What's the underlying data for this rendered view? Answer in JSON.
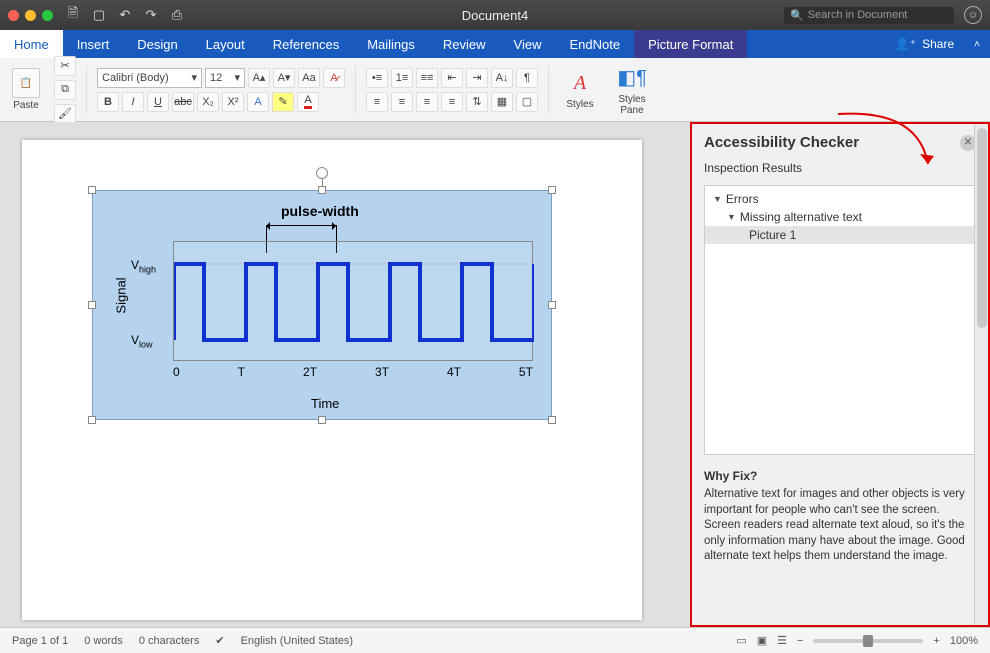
{
  "window": {
    "title": "Document4",
    "search_placeholder": "Search in Document"
  },
  "tabs": {
    "home": "Home",
    "insert": "Insert",
    "design": "Design",
    "layout": "Layout",
    "references": "References",
    "mailings": "Mailings",
    "review": "Review",
    "view": "View",
    "endnote": "EndNote",
    "picture_format": "Picture Format",
    "share": "Share"
  },
  "ribbon": {
    "paste": "Paste",
    "font_name": "Calibri (Body)",
    "font_size": "12",
    "styles": "Styles",
    "styles_pane": "Styles\nPane"
  },
  "picture": {
    "title": "pulse-width",
    "y_label": "Signal",
    "x_label": "Time",
    "v_high": "V",
    "v_high_sub": "high",
    "v_low": "V",
    "v_low_sub": "low",
    "x_ticks": [
      "0",
      "T",
      "2T",
      "3T",
      "4T",
      "5T"
    ]
  },
  "pane": {
    "title": "Accessibility Checker",
    "subtitle": "Inspection Results",
    "errors_label": "Errors",
    "err1": "Missing alternative text",
    "err1_item": "Picture 1",
    "why_title": "Why Fix?",
    "why_body": "Alternative text for images and other objects is very important for people who can't see the screen. Screen readers read alternate text aloud, so it's the only information many have about the image. Good alternate text helps them understand the image."
  },
  "status": {
    "page": "Page 1 of 1",
    "words": "0 words",
    "chars": "0 characters",
    "lang": "English (United States)",
    "zoom": "100%"
  },
  "chart_data": {
    "type": "line",
    "title": "pulse-width",
    "xlabel": "Time",
    "ylabel": "Signal",
    "y_levels": [
      "V_low",
      "V_high"
    ],
    "x_ticks": [
      "0",
      "T",
      "2T",
      "3T",
      "4T",
      "5T"
    ],
    "description": "Periodic square pulse train with period T; signal is at V_high for a pulse-width fraction of each period and V_low otherwise, repeating 5 periods."
  }
}
